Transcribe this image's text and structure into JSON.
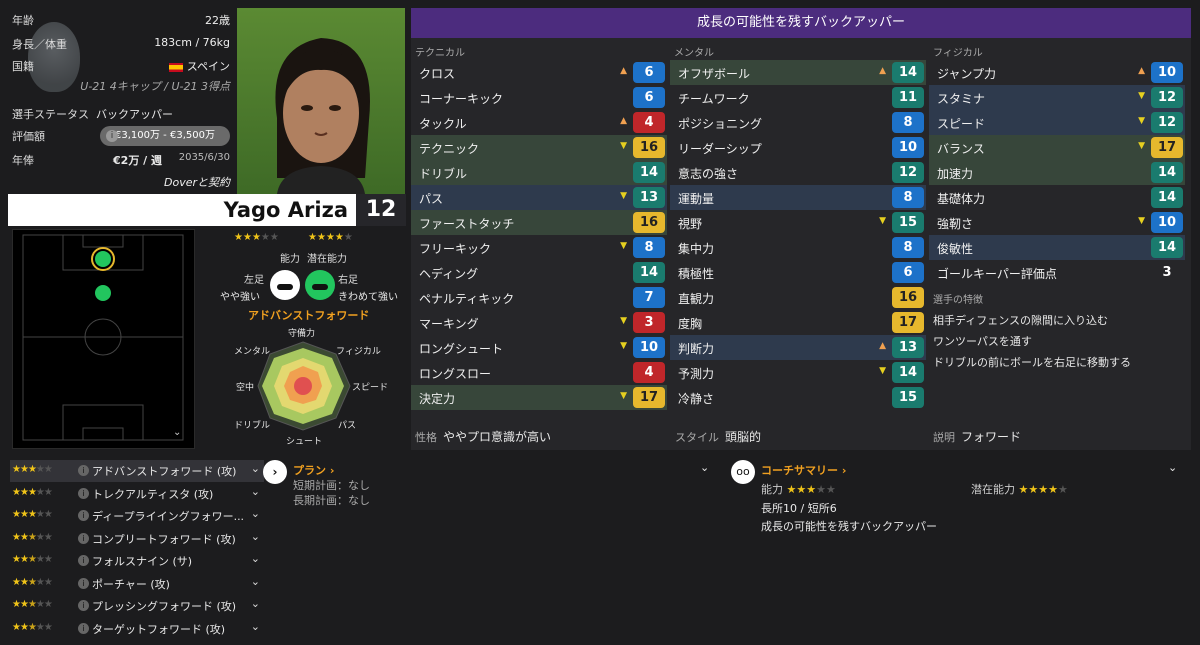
{
  "player": {
    "age_label": "年齢",
    "age_value": "22歳",
    "hw_label": "身長／体重",
    "hw_value": "183cm / 76kg",
    "nat_label": "国籍",
    "nat_value": "スペイン",
    "intl_value": "U-21 4キャップ / U-21 3得点",
    "status_label": "選手ステータス",
    "status_value": "バックアッパー",
    "valuation_label": "評価額",
    "valuation_value": "€3,100万 - €3,500万",
    "wage_label": "年俸",
    "wage_value": "€2万 / 週",
    "wage_expiry": "2035/6/30",
    "contract_club": "Doverと契約",
    "name": "Yago Ariza",
    "number": "12"
  },
  "ratings": {
    "ability_label": "能力",
    "potential_label": "潜在能力",
    "ability_stars": 3,
    "potential_stars": 4
  },
  "feet": {
    "left_label": "左足",
    "left_value": "やや強い",
    "right_label": "右足",
    "right_value": "きわめて強い"
  },
  "role_title": "アドバンストフォワード",
  "radar_labels": {
    "defense": "守備力",
    "physical": "フィジカル",
    "speed": "スピード",
    "pass": "パス",
    "shoot": "シュート",
    "dribble": "ドリブル",
    "aerial": "空中",
    "mental": "メンタル"
  },
  "attributes": {
    "header": "成長の可能性を残すバックアッパー",
    "technical_label": "テクニカル",
    "mental_label": "メンタル",
    "physical_label": "フィジカル",
    "technical": [
      {
        "name": "クロス",
        "value": "6",
        "arrow": "up",
        "color": "blue",
        "hl": ""
      },
      {
        "name": "コーナーキック",
        "value": "6",
        "arrow": "",
        "color": "blue",
        "hl": ""
      },
      {
        "name": "タックル",
        "value": "4",
        "arrow": "up",
        "color": "red",
        "hl": ""
      },
      {
        "name": "テクニック",
        "value": "16",
        "arrow": "down",
        "color": "gold",
        "hl": "green"
      },
      {
        "name": "ドリブル",
        "value": "14",
        "arrow": "",
        "color": "teal",
        "hl": "green"
      },
      {
        "name": "パス",
        "value": "13",
        "arrow": "down",
        "color": "teal",
        "hl": "blue"
      },
      {
        "name": "ファーストタッチ",
        "value": "16",
        "arrow": "",
        "color": "gold",
        "hl": "green"
      },
      {
        "name": "フリーキック",
        "value": "8",
        "arrow": "down",
        "color": "blue",
        "hl": ""
      },
      {
        "name": "ヘディング",
        "value": "14",
        "arrow": "",
        "color": "teal",
        "hl": ""
      },
      {
        "name": "ペナルティキック",
        "value": "7",
        "arrow": "",
        "color": "blue",
        "hl": ""
      },
      {
        "name": "マーキング",
        "value": "3",
        "arrow": "down",
        "color": "red",
        "hl": ""
      },
      {
        "name": "ロングシュート",
        "value": "10",
        "arrow": "down",
        "color": "blue",
        "hl": ""
      },
      {
        "name": "ロングスロー",
        "value": "4",
        "arrow": "",
        "color": "red",
        "hl": ""
      },
      {
        "name": "決定力",
        "value": "17",
        "arrow": "down",
        "color": "gold",
        "hl": "green"
      }
    ],
    "mental": [
      {
        "name": "オフザボール",
        "value": "14",
        "arrow": "up",
        "color": "teal",
        "hl": "green"
      },
      {
        "name": "チームワーク",
        "value": "11",
        "arrow": "",
        "color": "teal",
        "hl": ""
      },
      {
        "name": "ポジショニング",
        "value": "8",
        "arrow": "",
        "color": "blue",
        "hl": ""
      },
      {
        "name": "リーダーシップ",
        "value": "10",
        "arrow": "",
        "color": "blue",
        "hl": ""
      },
      {
        "name": "意志の強さ",
        "value": "12",
        "arrow": "",
        "color": "teal",
        "hl": ""
      },
      {
        "name": "運動量",
        "value": "8",
        "arrow": "",
        "color": "blue",
        "hl": "blue"
      },
      {
        "name": "視野",
        "value": "15",
        "arrow": "down",
        "color": "teal",
        "hl": ""
      },
      {
        "name": "集中力",
        "value": "8",
        "arrow": "",
        "color": "blue",
        "hl": ""
      },
      {
        "name": "積極性",
        "value": "6",
        "arrow": "",
        "color": "blue",
        "hl": ""
      },
      {
        "name": "直観力",
        "value": "16",
        "arrow": "",
        "color": "gold",
        "hl": ""
      },
      {
        "name": "度胸",
        "value": "17",
        "arrow": "",
        "color": "gold",
        "hl": ""
      },
      {
        "name": "判断力",
        "value": "13",
        "arrow": "up",
        "color": "teal",
        "hl": "blue"
      },
      {
        "name": "予測力",
        "value": "14",
        "arrow": "down",
        "color": "teal",
        "hl": ""
      },
      {
        "name": "冷静さ",
        "value": "15",
        "arrow": "",
        "color": "teal",
        "hl": ""
      }
    ],
    "physical": [
      {
        "name": "ジャンプ力",
        "value": "10",
        "arrow": "up",
        "color": "blue",
        "hl": ""
      },
      {
        "name": "スタミナ",
        "value": "12",
        "arrow": "down",
        "color": "teal",
        "hl": "blue"
      },
      {
        "name": "スピード",
        "value": "12",
        "arrow": "down",
        "color": "teal",
        "hl": "blue"
      },
      {
        "name": "バランス",
        "value": "17",
        "arrow": "down",
        "color": "gold",
        "hl": "green"
      },
      {
        "name": "加速力",
        "value": "14",
        "arrow": "",
        "color": "teal",
        "hl": "green"
      },
      {
        "name": "基礎体力",
        "value": "14",
        "arrow": "",
        "color": "teal",
        "hl": ""
      },
      {
        "name": "強靭さ",
        "value": "10",
        "arrow": "down",
        "color": "blue",
        "hl": ""
      },
      {
        "name": "俊敏性",
        "value": "14",
        "arrow": "",
        "color": "teal",
        "hl": "blue"
      },
      {
        "name": "ゴールキーパー評価点",
        "value": "3",
        "arrow": "",
        "color": "none",
        "hl": ""
      }
    ],
    "traits_label": "選手の特徴",
    "traits": [
      "相手ディフェンスの隙間に入り込む",
      "ワンツーパスを通す",
      "ドリブルの前にボールを右足に移動する"
    ],
    "personality_label": "性格",
    "personality_value": "ややプロ意識が高い",
    "style_label": "スタイル",
    "style_value": "頭脳的",
    "desc_label": "説明",
    "desc_value": "フォワード"
  },
  "roles": [
    {
      "name": "アドバンストフォワード (攻)",
      "stars": 3
    },
    {
      "name": "トレクアルティスタ (攻)",
      "stars": 3
    },
    {
      "name": "ディープライイングフォワー...",
      "stars": 3
    },
    {
      "name": "コンプリートフォワード (攻)",
      "stars": 2.5
    },
    {
      "name": "フォルスナイン (サ)",
      "stars": 2.5
    },
    {
      "name": "ポーチャー (攻)",
      "stars": 2.5
    },
    {
      "name": "プレッシングフォワード (攻)",
      "stars": 2.5
    },
    {
      "name": "ターゲットフォワード (攻)",
      "stars": 2.5
    }
  ],
  "plan": {
    "title": "プラン",
    "short_label": "短期計画：",
    "short_value": "なし",
    "long_label": "長期計画：",
    "long_value": "なし"
  },
  "coach": {
    "title": "コーチサマリー",
    "ability_label": "能力",
    "ability_stars": 3,
    "potential_label": "潜在能力",
    "potential_stars": 4,
    "strengths": "長所10 / 短所6",
    "summary": "成長の可能性を残すバックアッパー"
  },
  "colors": {
    "accent": "#4c2c7e",
    "gold": "#e6b82d",
    "teal": "#1a7b6e",
    "blue": "#1d72c9",
    "red": "#c0262a",
    "plan_orange": "#f0a020"
  }
}
